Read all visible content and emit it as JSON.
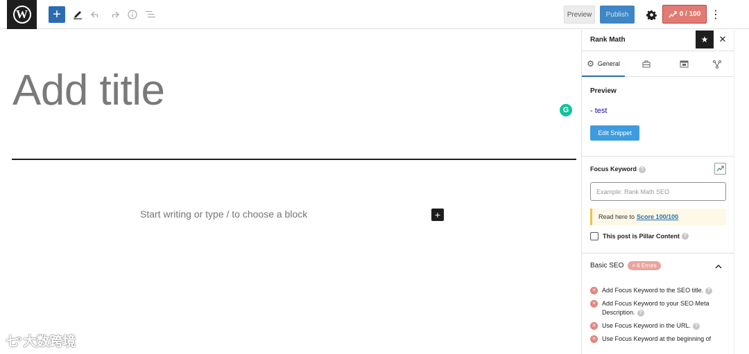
{
  "toolbar": {
    "logo_glyph": "W",
    "inserter_glyph": "+",
    "tool_icons": [
      "pencil-icon",
      "undo-icon",
      "redo-icon",
      "info-icon",
      "list-view-icon"
    ],
    "preview_label": "Preview",
    "publish_label": "Publish",
    "seo_score": "0 / 100",
    "accent_color": "#2b6cb0",
    "score_color": "#e27b73"
  },
  "editor": {
    "title_placeholder": "Add title",
    "body_placeholder": "Start writing or type / to choose a block",
    "block_plus_glyph": "+"
  },
  "sidebar": {
    "title": "Rank Math",
    "tabs": [
      {
        "label": "General",
        "icon": "gear-icon",
        "active": true
      },
      {
        "label": "",
        "icon": "toolbox-icon"
      },
      {
        "label": "",
        "icon": "schema-icon"
      },
      {
        "label": "",
        "icon": "social-icon"
      }
    ],
    "preview": {
      "heading": "Preview",
      "snippet_title": "- test",
      "edit_button": "Edit Snippet"
    },
    "focus_keyword": {
      "label": "Focus Keyword",
      "placeholder": "Example: Rank Math SEO",
      "notice_text": "Read here to",
      "notice_link": "Score 100/100",
      "pillar_label": "This post is Pillar Content"
    },
    "basic_seo": {
      "heading": "Basic SEO",
      "errors_badge": "× 6 Errors",
      "items": [
        "Add Focus Keyword to the SEO title.",
        "Add Focus Keyword to your SEO Meta Description.",
        "Use Focus Keyword in the URL.",
        "Use Focus Keyword at the beginning of"
      ]
    }
  },
  "watermark": {
    "logo": "七°",
    "text": "大数跨境"
  }
}
